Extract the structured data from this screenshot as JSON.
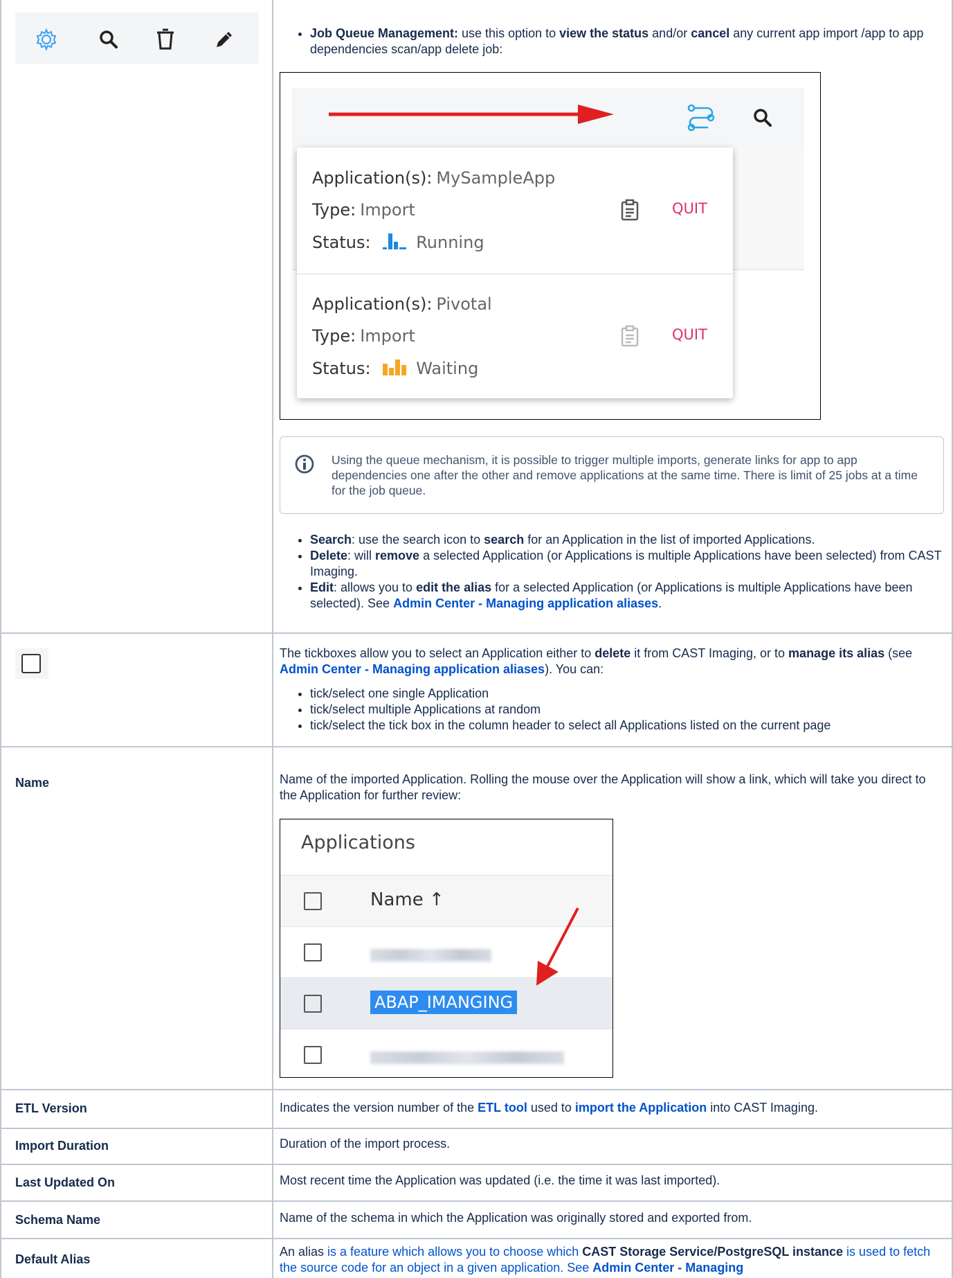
{
  "toolbar": {
    "icons": [
      "gear-icon",
      "search-icon",
      "trash-icon",
      "pencil-icon"
    ],
    "accent": "#3aa0f3"
  },
  "row_icons": {
    "job_queue": {
      "bullet_label": "Job Queue Management:",
      "t1": " use this option to ",
      "b1": "view the status",
      "t2": " and/or ",
      "b2": "cancel",
      "t3": " any current app import /app to app dependencies scan/app delete job:"
    },
    "job_popup": {
      "jobs": [
        {
          "app_key": "Application(s):",
          "app_val": "MySampleApp",
          "type_key": "Type:",
          "type_val": "Import",
          "status_key": "Status:",
          "status_val": "Running",
          "quit": "QUIT",
          "status_color": "#1e88e5"
        },
        {
          "app_key": "Application(s):",
          "app_val": "Pivotal",
          "type_key": "Type:",
          "type_val": "Import",
          "status_key": "Status:",
          "status_val": "Waiting",
          "quit": "QUIT",
          "status_color": "#f5a623"
        }
      ]
    },
    "info": "Using the queue mechanism, it is possible to trigger multiple imports, generate links for app to app dependencies one after the other and remove applications at the same time. There is limit of 25 jobs at a time for the job queue.",
    "search": {
      "label": "Search",
      "t1": ": use the search icon to ",
      "b1": "search",
      "t2": " for an Application in the list of imported Applications."
    },
    "delete": {
      "label": "Delete",
      "t1": ": will ",
      "b1": "remove",
      "t2": " a selected Application (or Applications is multiple Applications have been selected) from CAST Imaging."
    },
    "edit": {
      "label": "Edit",
      "t1": ": allows you to ",
      "b1": "edit the alias",
      "t2": " for a selected Application (or Applications is multiple Applications have been selected). See ",
      "link": "Admin Center - Managing application aliases",
      "t3": "."
    }
  },
  "row_tickbox": {
    "t1": "The tickboxes allow you to select an Application either to ",
    "b1": "delete",
    "t2": " it from CAST Imaging, or to ",
    "b2": "manage its alias",
    "t3": " (see ",
    "link": "Admin Center - Managing application aliases",
    "t4": "). You can:",
    "items": [
      "tick/select one single Application",
      "tick/select multiple Applications at random",
      "tick/select the tick box in the column header to select all Applications listed on the current page"
    ]
  },
  "row_name": {
    "label": "Name",
    "desc": "Name of the imported Application. Rolling the mouse over the Application will show a link, which will take you direct to the Application for further review:",
    "apps_panel": {
      "title": "Applications",
      "col_name": "Name ↑",
      "highlighted": "ABAP_IMANGING"
    }
  },
  "row_etl": {
    "label": "ETL Version",
    "t1": "Indicates the version number of the ",
    "link1": "ETL tool",
    "t2": " used to ",
    "link2": "import the Application",
    "t3": " into CAST Imaging."
  },
  "row_duration": {
    "label": "Import Duration",
    "desc": "Duration of the import process."
  },
  "row_updated": {
    "label": "Last Updated On",
    "desc": "Most recent time the Application was updated (i.e. the time it was last imported)."
  },
  "row_schema": {
    "label": "Schema Name",
    "desc": "Name of the schema in which the Application was originally stored and exported from."
  },
  "row_alias": {
    "label": "Default Alias",
    "t1": "An alias ",
    "t2": "is a feature which allows you to choose which ",
    "b1": "CAST Storage Service/PostgreSQL instance",
    "t3": " is used to fetch the source code for an object in a given application. See ",
    "link": "Admin Center - Managing"
  }
}
